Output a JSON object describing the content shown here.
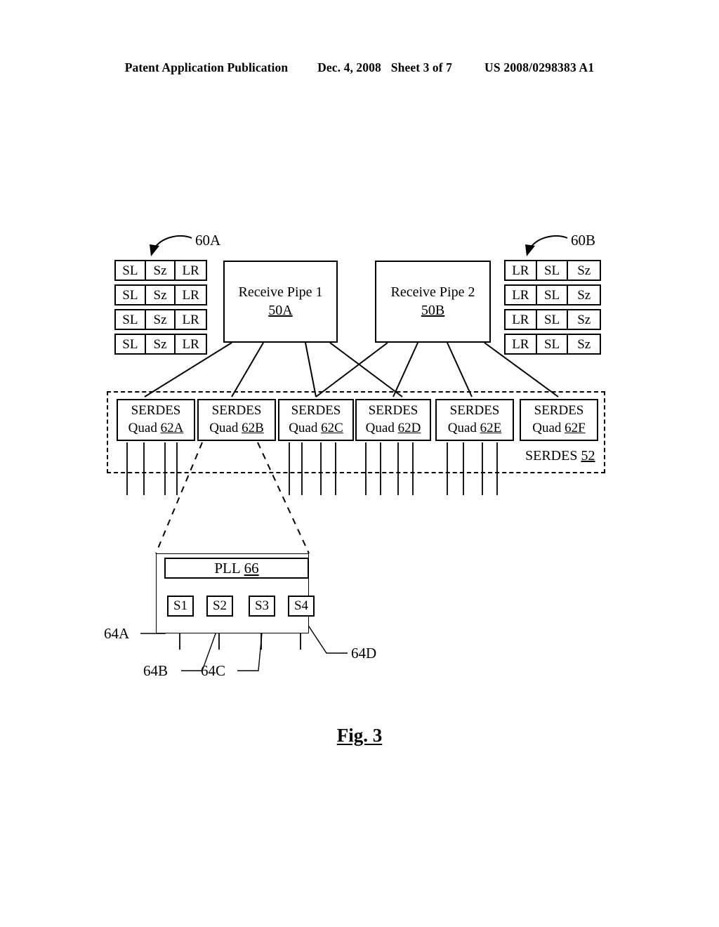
{
  "header": {
    "publication": "Patent Application Publication",
    "date": "Dec. 4, 2008",
    "sheet": "Sheet 3 of 7",
    "patent_number": "US 2008/0298383 A1"
  },
  "figure": {
    "caption": "Fig. 3"
  },
  "ports": {
    "left": {
      "ref": "60A",
      "cells": [
        "SL",
        "Sz",
        "LR"
      ],
      "rows": [
        [
          "SL",
          "Sz",
          "LR"
        ],
        [
          "SL",
          "Sz",
          "LR"
        ],
        [
          "SL",
          "Sz",
          "LR"
        ],
        [
          "SL",
          "Sz",
          "LR"
        ]
      ]
    },
    "right": {
      "ref": "60B",
      "cells": [
        "LR",
        "SL",
        "Sz"
      ],
      "rows": [
        [
          "LR",
          "SL",
          "Sz"
        ],
        [
          "LR",
          "SL",
          "Sz"
        ],
        [
          "LR",
          "SL",
          "Sz"
        ],
        [
          "LR",
          "SL",
          "Sz"
        ]
      ]
    }
  },
  "pipes": [
    {
      "title": "Receive Pipe 1",
      "ref": "50A"
    },
    {
      "title": "Receive Pipe 2",
      "ref": "50B"
    }
  ],
  "serdes": {
    "container_label": "SERDES",
    "container_ref": "52",
    "quads": [
      {
        "line1": "SERDES",
        "line2": "Quad",
        "ref": "62A"
      },
      {
        "line1": "SERDES",
        "line2": "Quad",
        "ref": "62B"
      },
      {
        "line1": "SERDES",
        "line2": "Quad",
        "ref": "62C"
      },
      {
        "line1": "SERDES",
        "line2": "Quad",
        "ref": "62D"
      },
      {
        "line1": "SERDES",
        "line2": "Quad",
        "ref": "62E"
      },
      {
        "line1": "SERDES",
        "line2": "Quad",
        "ref": "62F"
      }
    ]
  },
  "pll": {
    "label": "PLL",
    "ref": "66",
    "selectors": [
      "S1",
      "S2",
      "S3",
      "S4"
    ],
    "leaders": [
      "64A",
      "64B",
      "64C",
      "64D"
    ]
  },
  "colors": {
    "ink": "#000000",
    "paper": "#ffffff"
  }
}
